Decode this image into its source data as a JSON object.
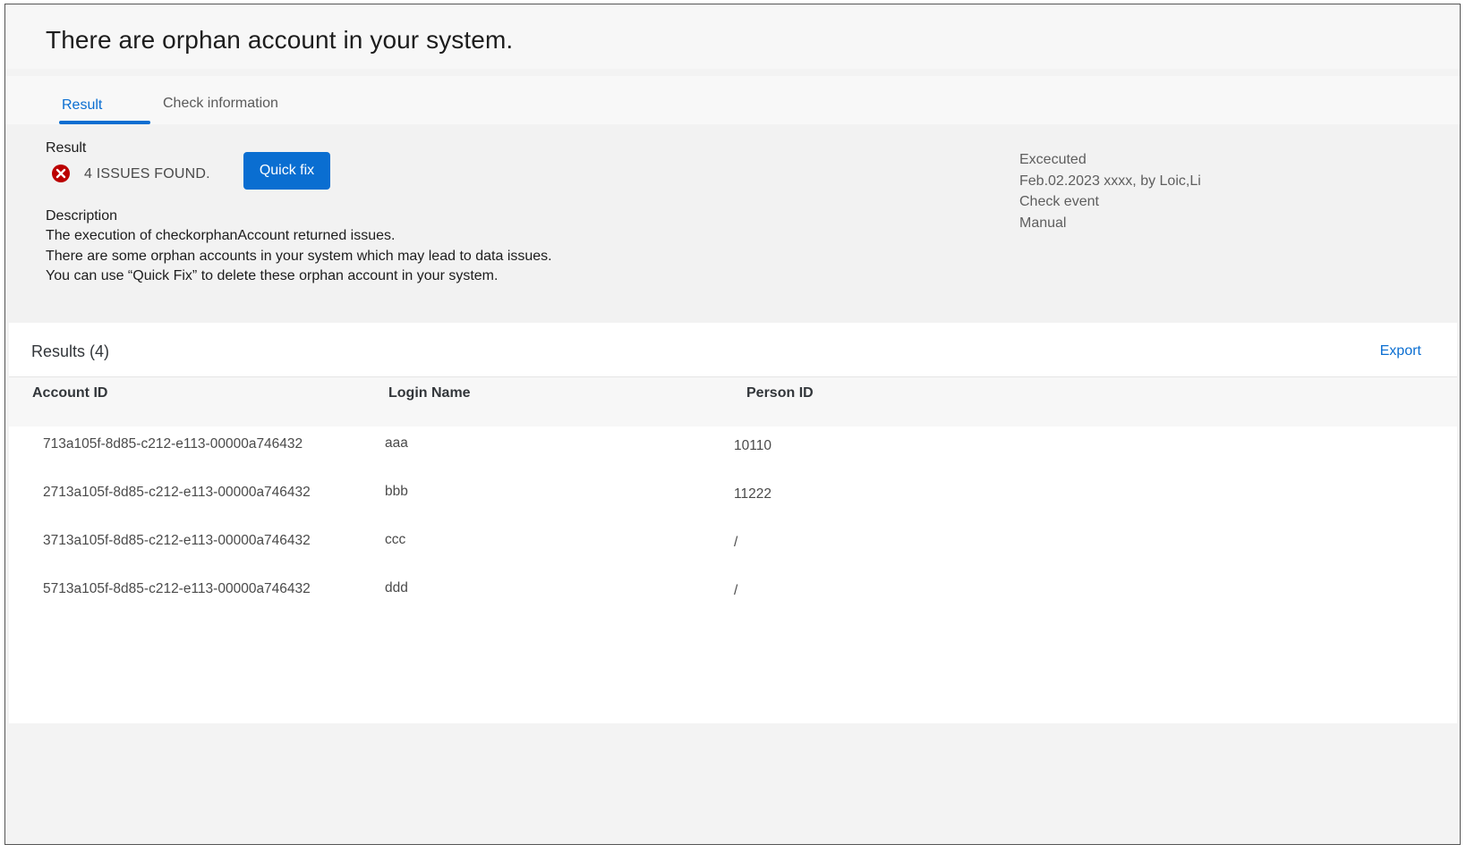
{
  "page_title": "There are orphan account in your system.",
  "tabs": [
    {
      "label": "Result",
      "selected": true
    },
    {
      "label": "Check information",
      "selected": false
    }
  ],
  "summary": {
    "result_label": "Result",
    "issues_text": "4 ISSUES FOUND.",
    "status_icon": "error-circle-icon",
    "quick_fix_label": "Quick fix",
    "description_heading": "Description",
    "description_lines": [
      "The execution of checkorphanAccount returned issues.",
      "There are some orphan accounts in your system which may lead to data issues.",
      "You can use “Quick Fix” to delete these orphan account in your system."
    ],
    "meta": {
      "executed_label": "Excecuted",
      "executed_value": "Feb.02.2023 xxxx, by Loic,Li",
      "event_label": "Check event",
      "event_value": "Manual"
    }
  },
  "results": {
    "title": "Results (4)",
    "export_label": "Export",
    "columns": [
      "Account ID",
      "Login Name",
      "Person ID"
    ],
    "rows": [
      {
        "account_id": "713a105f-8d85-c212-e113-00000a746432",
        "login_name": "aaa",
        "person_id": "10110"
      },
      {
        "account_id": "2713a105f-8d85-c212-e113-00000a746432",
        "login_name": "bbb",
        "person_id": "11222"
      },
      {
        "account_id": "3713a105f-8d85-c212-e113-00000a746432",
        "login_name": "ccc",
        "person_id": "/"
      },
      {
        "account_id": "5713a105f-8d85-c212-e113-00000a746432",
        "login_name": "ddd",
        "person_id": "/"
      }
    ]
  },
  "colors": {
    "accent": "#0a6ed1",
    "error": "#bb0000"
  }
}
